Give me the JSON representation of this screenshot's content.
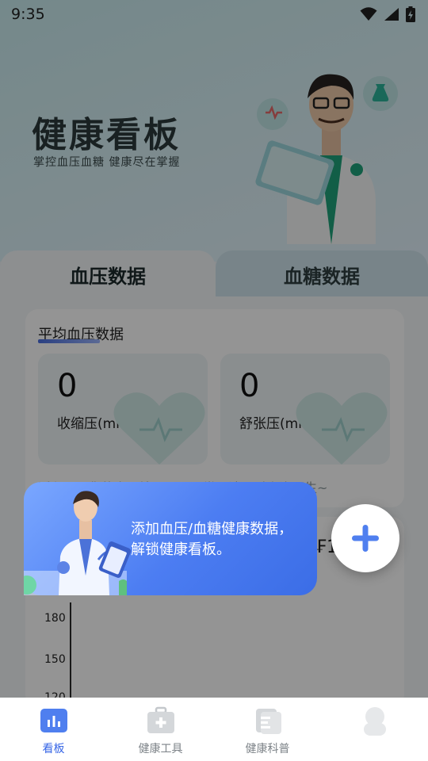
{
  "status": {
    "time": "9:35"
  },
  "hero": {
    "title": "健康看板",
    "subtitle": "掌控血压血糖 健康尽在掌握"
  },
  "tabs": [
    {
      "label": "血压数据",
      "active": true
    },
    {
      "label": "血糖数据",
      "active": false
    }
  ],
  "average_card": {
    "title": "平均血压数据",
    "stats": [
      {
        "value": "0",
        "label": "收缩压(mmHg)"
      },
      {
        "value": "0",
        "label": "舒张压(mmHg)"
      }
    ],
    "tip": "近七天，您的血压情况一切正常，请及时咨询医生~"
  },
  "chart": {
    "peek_text": "₣1",
    "y_ticks": [
      "180",
      "150",
      "120"
    ]
  },
  "guide": {
    "message": "添加血压/血糖健康数据，解锁健康看板。"
  },
  "bottom_nav": [
    {
      "label": "看板",
      "icon": "dashboard-icon",
      "active": true
    },
    {
      "label": "健康工具",
      "icon": "medical-kit-icon",
      "active": false
    },
    {
      "label": "健康科普",
      "icon": "document-icon",
      "active": false
    },
    {
      "label": "",
      "icon": "profile-icon",
      "active": false
    }
  ],
  "colors": {
    "accent": "#3766e6",
    "bubble": "#4c7df2",
    "hero_bg": "#c9ecef"
  }
}
